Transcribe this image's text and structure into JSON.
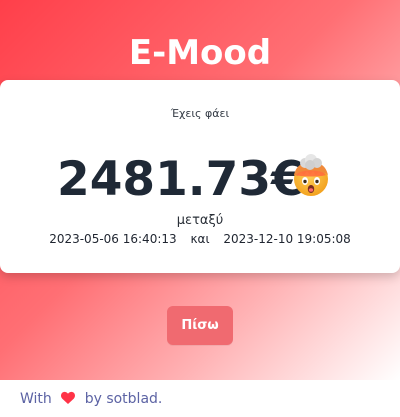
{
  "app": {
    "title": "E-Mood"
  },
  "card": {
    "subtitle": "Έχεις φάει",
    "amount": "2481.73€",
    "between_label": "μεταξύ",
    "start_datetime": "2023-05-06 16:40:13",
    "connector": "και",
    "end_datetime": "2023-12-10 19:05:08",
    "emoji_icon": "exploding-head-emoji-icon"
  },
  "actions": {
    "back_label": "Πίσω"
  },
  "footer": {
    "prefix": "With",
    "heart_icon": "heart-icon",
    "suffix": "by sotblad."
  },
  "colors": {
    "gradient_start": "#ff3f4a",
    "gradient_end": "#ffffff",
    "button": "#f06a70",
    "footer_text": "#5c63a4",
    "amount_text": "#1f2936"
  }
}
